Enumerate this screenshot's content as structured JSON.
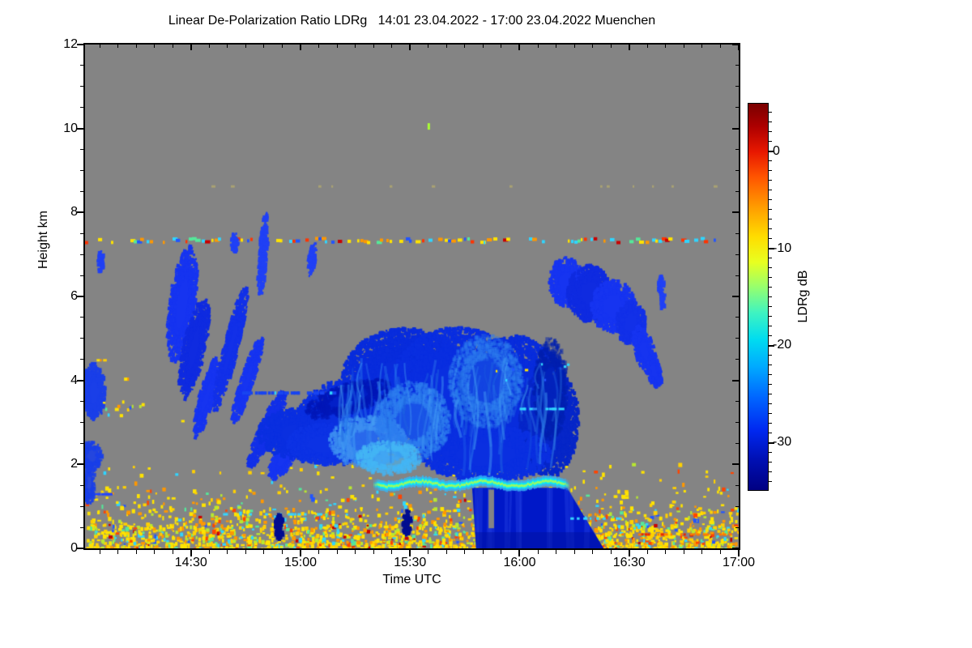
{
  "title": "Linear De-Polarization Ratio LDRg   14:01 23.04.2022 - 17:00 23.04.2022 Muenchen",
  "chart_data": {
    "type": "heatmap",
    "title": "Linear De-Polarization Ratio LDRg   14:01 23.04.2022 - 17:00 23.04.2022 Muenchen",
    "station": "Muenchen",
    "date": "23.04.2022",
    "time_span_utc": [
      "14:01",
      "17:00"
    ],
    "xlabel": "Time UTC",
    "ylabel": "Height km",
    "ylim_km": [
      0,
      12
    ],
    "x_total_minutes": 179,
    "x_ticks": [
      {
        "t": 29,
        "label": "14:30"
      },
      {
        "t": 59,
        "label": "15:00"
      },
      {
        "t": 89,
        "label": "15:30"
      },
      {
        "t": 119,
        "label": "16:00"
      },
      {
        "t": 149,
        "label": "16:30"
      },
      {
        "t": 179,
        "label": "17:00"
      }
    ],
    "x_minor_step_min": 5,
    "y_ticks": [
      {
        "km": 0,
        "label": "0"
      },
      {
        "km": 2,
        "label": "2"
      },
      {
        "km": 4,
        "label": "4"
      },
      {
        "km": 6,
        "label": "6"
      },
      {
        "km": 8,
        "label": "8"
      },
      {
        "km": 10,
        "label": "10"
      },
      {
        "km": 12,
        "label": "12"
      }
    ],
    "y_minor_step_km": 0.5,
    "colorbar": {
      "label": "LDRg dB",
      "max_db": 5,
      "min_db": -35,
      "ticks": [
        {
          "db": 0,
          "label": "0"
        },
        {
          "db": -10,
          "label": "-10"
        },
        {
          "db": -20,
          "label": "-20"
        },
        {
          "db": -30,
          "label": "-30"
        }
      ],
      "minor_step_db": 1,
      "colormap": "jet",
      "stops": [
        [
          0.0,
          "#7A0000"
        ],
        [
          0.06,
          "#AE0000"
        ],
        [
          0.125,
          "#E81800"
        ],
        [
          0.19,
          "#FF5500"
        ],
        [
          0.27,
          "#FF9E00"
        ],
        [
          0.345,
          "#FFDD00"
        ],
        [
          0.41,
          "#E8FF20"
        ],
        [
          0.475,
          "#96FF6E"
        ],
        [
          0.54,
          "#40F4C0"
        ],
        [
          0.61,
          "#00DCF0"
        ],
        [
          0.68,
          "#00AAFF"
        ],
        [
          0.76,
          "#0066FF"
        ],
        [
          0.845,
          "#0028F0"
        ],
        [
          0.92,
          "#0010B4"
        ],
        [
          1.0,
          "#000082"
        ]
      ]
    },
    "no_data_color": "#848484",
    "palettes": {
      "warm": [
        [
          "#FFE300",
          40
        ],
        [
          "#FFD000",
          18
        ],
        [
          "#FF9800",
          14
        ],
        [
          "#B8E830",
          8
        ],
        [
          "#55E89A",
          5
        ],
        [
          "#30D5FF",
          6
        ],
        [
          "#FF4400",
          5
        ],
        [
          "#C80000",
          2
        ],
        [
          "#2255FF",
          2
        ]
      ],
      "line73": [
        [
          "#FFE300",
          25
        ],
        [
          "#FF9800",
          18
        ],
        [
          "#FF3300",
          12
        ],
        [
          "#30D5FF",
          18
        ],
        [
          "#55E89A",
          10
        ],
        [
          "#2255FF",
          12
        ],
        [
          "#C80000",
          5
        ]
      ]
    },
    "features": {
      "ground_speckle_bands": [
        {
          "km0": 0.0,
          "km1": 0.18,
          "density": 0.85,
          "palette": "warm"
        },
        {
          "km0": 0.18,
          "km1": 0.6,
          "density": 0.5,
          "palette": "warm"
        },
        {
          "km0": 0.6,
          "km1": 0.95,
          "density": 0.22,
          "palette": "warm"
        },
        {
          "km0": 0.95,
          "km1": 1.5,
          "density": 0.08,
          "palette": "warm"
        },
        {
          "km0": 1.5,
          "km1": 2.05,
          "density": 0.02,
          "palette": "warm"
        }
      ],
      "speckle_rows_under": [
        {
          "name": "artifact-line-7.3km",
          "t0": 0,
          "t1": 179,
          "km": 7.33,
          "cov": 0.5,
          "palette": "line73",
          "h": 4,
          "wmax": 7,
          "spread": 0.1
        },
        {
          "name": "faint-line-8.6km",
          "t0": 0,
          "t1": 179,
          "km": 8.62,
          "cov": 0.07,
          "colors": [
            [
              "#D8C860",
              1
            ]
          ],
          "alpha": 0.45,
          "h": 3,
          "wmax": 5
        },
        {
          "name": "row-4.5km-left",
          "t0": 0.5,
          "t1": 12.5,
          "km": 4.48,
          "cov": 0.15,
          "palette": "warm",
          "h": 3,
          "wmax": 5
        },
        {
          "name": "row-4.0km-left",
          "t0": 1.8,
          "t1": 13.5,
          "km": 4.03,
          "cov": 0.3,
          "colors": [
            [
              "#30D5FF",
              40
            ],
            [
              "#FF9800",
              25
            ],
            [
              "#FFE300",
              35
            ]
          ],
          "h": 4,
          "wmax": 6
        },
        {
          "name": "cluster-3.3km-left",
          "t0": 1.5,
          "t1": 16,
          "km": 3.32,
          "cov": 0.55,
          "palette": "warm",
          "h": 4,
          "spread": 0.35,
          "step": 3,
          "wmax": 5
        },
        {
          "name": "row-3.0km",
          "t0": 21,
          "t1": 44,
          "km": 3.03,
          "cov": 0.15,
          "colors": [
            [
              "#FFE300",
              70
            ],
            [
              "#55E89A",
              30
            ]
          ],
          "h": 3,
          "wmax": 5
        },
        {
          "name": "cyan-1km-left",
          "t0": 36,
          "t1": 66,
          "km": 0.81,
          "cov": 0.35,
          "colors": [
            [
              "#35D5FF",
              85
            ],
            [
              "#2255FF",
              15
            ]
          ],
          "h": 3,
          "wmax": 7
        },
        {
          "name": "blue-dashes-1.3km-left",
          "t0": 1.8,
          "t1": 6.4,
          "km": 1.29,
          "cov": 0.8,
          "colors": [
            [
              "#2244FF",
              1
            ]
          ],
          "h": 3,
          "wmax": 8
        },
        {
          "name": "green-dash-10km",
          "t0": 93.8,
          "t1": 94.6,
          "km": 10.05,
          "cov": 1,
          "colors": [
            [
              "#AAFF33",
              1
            ]
          ],
          "h": 8,
          "wmax": 3
        }
      ],
      "blobs": [
        {
          "name": "fallstreak-a1",
          "t": 26.6,
          "km": 5.83,
          "rt": 3.1,
          "rkm": 1.2,
          "rot": 8,
          "color": "#1634F0"
        },
        {
          "name": "fallstreak-a2",
          "t": 29.9,
          "km": 4.77,
          "rt": 2.7,
          "rkm": 1.06,
          "rot": 12,
          "color": "#0F2BE0"
        },
        {
          "name": "fallstreak-a3",
          "t": 33.3,
          "km": 3.61,
          "rt": 1.8,
          "rkm": 0.87,
          "rot": 15,
          "color": "#1634F0"
        },
        {
          "name": "fallstreak-b",
          "t": 39.9,
          "km": 4.77,
          "rt": 1.8,
          "rkm": 1.35,
          "rot": 14,
          "color": "#1230E8"
        },
        {
          "name": "fallstreak-c1",
          "t": 44.4,
          "km": 3.99,
          "rt": 1.55,
          "rkm": 0.96,
          "rot": 18,
          "color": "#1634F0"
        },
        {
          "name": "fallstreak-c2",
          "t": 49.9,
          "km": 2.84,
          "rt": 2.0,
          "rkm": 0.87,
          "rot": 25,
          "color": "#1230E8"
        },
        {
          "name": "fallstreak-c3",
          "t": 54.8,
          "km": 2.22,
          "rt": 2.4,
          "rkm": 0.58,
          "rot": 30,
          "color": "#1634F0"
        },
        {
          "name": "streak-tall-1449",
          "t": 48.8,
          "km": 7.0,
          "rt": 1.0,
          "rkm": 0.89,
          "rot": 4,
          "color": "#2040F5"
        },
        {
          "name": "streak-bit",
          "t": 41.0,
          "km": 7.27,
          "rt": 0.9,
          "rkm": 0.23,
          "rot": 0,
          "color": "#2040F5"
        },
        {
          "name": "streak-1505",
          "t": 62.1,
          "km": 6.89,
          "rt": 0.9,
          "rkm": 0.35,
          "rot": 8,
          "color": "#2040F5"
        },
        {
          "name": "left-edge-patch",
          "t": 2.4,
          "km": 3.74,
          "rt": 2.9,
          "rkm": 0.58,
          "rot": 0,
          "color": "#1A3FE8"
        },
        {
          "name": "left-edge-dash-6.8km",
          "t": 4.4,
          "km": 6.83,
          "rt": 0.7,
          "rkm": 0.23,
          "rot": 0,
          "color": "#2040F5"
        },
        {
          "name": "left-edge-low1",
          "t": 1.7,
          "km": 2.2,
          "rt": 2.6,
          "rkm": 0.3,
          "rot": 0,
          "color": "#1A3FE8",
          "alpha": 0.9
        },
        {
          "name": "left-edge-low2",
          "t": 1.1,
          "km": 1.55,
          "rt": 1.4,
          "rkm": 0.45,
          "rot": 0,
          "color": "#1A3FE8",
          "alpha": 0.85
        },
        {
          "name": "main-cloud-1",
          "t": 58.8,
          "km": 2.74,
          "rt": 10.0,
          "rkm": 0.52,
          "rot": 0,
          "color": "#0A2FE0"
        },
        {
          "name": "main-cloud-2",
          "t": 72.1,
          "km": 3.03,
          "rt": 12.2,
          "rkm": 0.87,
          "rot": 0,
          "color": "#0A2FE0"
        },
        {
          "name": "main-cloud-3",
          "t": 87.6,
          "km": 3.96,
          "rt": 15.1,
          "rkm": 1.12,
          "rot": 0,
          "color": "#082CDC"
        },
        {
          "name": "main-cloud-4",
          "t": 102.0,
          "km": 3.67,
          "rt": 16.6,
          "rkm": 1.39,
          "rot": 0,
          "color": "#092EE0"
        },
        {
          "name": "main-cloud-5",
          "t": 117.6,
          "km": 3.51,
          "rt": 12.9,
          "rkm": 1.35,
          "rot": 0,
          "color": "#082CDC"
        },
        {
          "name": "main-cloud-6",
          "t": 127.1,
          "km": 3.03,
          "rt": 7.1,
          "rkm": 1.12,
          "rot": 0,
          "color": "#0626C8"
        },
        {
          "name": "main-cloud-7",
          "t": 109.8,
          "km": 2.26,
          "rt": 15.5,
          "rkm": 0.58,
          "rot": 0,
          "color": "#0A2FE0"
        },
        {
          "name": "main-cloud-8",
          "t": 65.4,
          "km": 2.49,
          "rt": 8.9,
          "rkm": 0.42,
          "rot": 0,
          "color": "#0C32E4"
        },
        {
          "name": "main-cloud-dark-top",
          "t": 72.1,
          "km": 3.57,
          "rt": 10.6,
          "rkm": 0.31,
          "rot": -18,
          "color": "#0018B8",
          "alpha": 0.6
        },
        {
          "name": "main-cloud-dark-right",
          "t": 127.5,
          "km": 3.8,
          "rt": 4.0,
          "rkm": 1.06,
          "rot": 0,
          "color": "#001FB0",
          "alpha": 0.5
        },
        {
          "name": "main-cloud-light-1",
          "t": 77.6,
          "km": 2.55,
          "rt": 9.3,
          "rkm": 0.54,
          "rot": 0,
          "color": "#3E8FF2",
          "alpha": 0.6
        },
        {
          "name": "main-cloud-light-2",
          "t": 89.8,
          "km": 3.03,
          "rt": 8.9,
          "rkm": 0.81,
          "rot": 0,
          "color": "#2E7FF0",
          "alpha": 0.45
        },
        {
          "name": "main-cloud-light-3",
          "t": 109.8,
          "km": 3.99,
          "rt": 8.9,
          "rkm": 0.96,
          "rot": 0,
          "color": "#2E7FF0",
          "alpha": 0.3
        },
        {
          "name": "main-cloud-bright-low",
          "t": 83.2,
          "km": 2.16,
          "rt": 7.8,
          "rkm": 0.35,
          "rot": 0,
          "color": "#45B5F5",
          "alpha": 0.6
        },
        {
          "name": "right-cloud-1",
          "t": 132.0,
          "km": 6.35,
          "rt": 4.4,
          "rkm": 0.5,
          "rot": 0,
          "color": "#1634F0"
        },
        {
          "name": "right-cloud-2",
          "t": 138.2,
          "km": 6.08,
          "rt": 5.3,
          "rkm": 0.58,
          "rot": 0,
          "color": "#0F2BE0"
        },
        {
          "name": "right-cloud-3",
          "t": 144.6,
          "km": 5.77,
          "rt": 5.3,
          "rkm": 0.54,
          "rot": 0,
          "color": "#1634F0"
        },
        {
          "name": "right-cloud-4",
          "t": 149.5,
          "km": 5.38,
          "rt": 3.5,
          "rkm": 0.46,
          "rot": 0,
          "color": "#1230E8"
        },
        {
          "name": "right-cloud-tail-1",
          "t": 153.1,
          "km": 4.73,
          "rt": 2.4,
          "rkm": 0.52,
          "rot": -15,
          "color": "#1634F0"
        },
        {
          "name": "right-cloud-tail-2",
          "t": 155.9,
          "km": 4.23,
          "rt": 1.6,
          "rkm": 0.35,
          "rot": -10,
          "color": "#1634F0"
        },
        {
          "name": "right-cloud-dash-1",
          "t": 157.7,
          "km": 6.31,
          "rt": 0.7,
          "rkm": 0.23,
          "rot": 0,
          "color": "#2040F5"
        },
        {
          "name": "right-cloud-dash-2",
          "t": 158.2,
          "km": 5.92,
          "rt": 0.7,
          "rkm": 0.17,
          "rot": 0,
          "color": "#2040F5"
        },
        {
          "name": "right-cloud-bit",
          "t": 129.8,
          "km": 6.69,
          "rt": 1.3,
          "rkm": 0.15,
          "rot": 0,
          "color": "#1634F0"
        },
        {
          "name": "navy-column-1",
          "t": 53.2,
          "km": 0.52,
          "rt": 1.1,
          "rkm": 0.27,
          "rot": 0,
          "color": "#000D90"
        },
        {
          "name": "navy-column-2",
          "t": 88.1,
          "km": 0.6,
          "rt": 1.1,
          "rkm": 0.27,
          "rot": 0,
          "color": "#000D90"
        }
      ],
      "wisps": {
        "count": 90,
        "t0": 69,
        "t1": 130,
        "km_top": 4.6,
        "km_bot": 1.8,
        "colors": [
          "#2E86F0",
          "#49A5F5",
          "#1E66E0"
        ]
      },
      "melting_band": {
        "t0": 78.5,
        "t1": 132.6,
        "km": 1.55,
        "amp_km": 0.06,
        "color_outer": "#35B8F8",
        "color_mid": "#00F0FF",
        "color_core": "#A6FF55"
      },
      "rain_shaft": {
        "poly": [
          [
            106.0,
            1.44
          ],
          [
            132.0,
            1.44
          ],
          [
            142.0,
            0.0
          ],
          [
            107.1,
            0.0
          ]
        ],
        "color": "#0018C8",
        "streak_color": "#2A4AE8",
        "base_color": "#000FA0",
        "notch": {
          "t0": 110.5,
          "t1": 112.0,
          "km0": 0.48,
          "km1": 1.4
        }
      },
      "speckle_rows_over": [
        {
          "name": "blue-dash-row-3.7km",
          "t0": 43,
          "t1": 70,
          "km": 3.7,
          "cov": 0.5,
          "colors": [
            [
              "#1844F0",
              80
            ],
            [
              "#30D5FF",
              20
            ]
          ],
          "h": 4,
          "wmax": 8
        },
        {
          "name": "speckles-cloud-top",
          "t0": 108,
          "t1": 132,
          "km": 4.25,
          "cov": 0.2,
          "colors": [
            [
              "#30D5FF",
              40
            ],
            [
              "#FFE300",
              35
            ],
            [
              "#2255FF",
              25
            ]
          ],
          "h": 3,
          "spread": 0.5,
          "wmax": 5
        },
        {
          "name": "cyan-row-3.3km",
          "t0": 119,
          "t1": 131,
          "km": 3.32,
          "cov": 0.35,
          "colors": [
            [
              "#30D5FF",
              70
            ],
            [
              "#2E86F0",
              30
            ]
          ],
          "h": 3,
          "wmax": 8
        },
        {
          "name": "cyan-1km-right",
          "t0": 132,
          "t1": 147.5,
          "km": 0.71,
          "cov": 0.35,
          "colors": [
            [
              "#35D5FF",
              1
            ]
          ],
          "h": 3,
          "wmax": 6
        },
        {
          "name": "orange-dotted-line-right",
          "t0": 147,
          "t1": 179,
          "km": 0.33,
          "cov": 0.5,
          "colors": [
            [
              "#FF7A00",
              55
            ],
            [
              "#E82800",
              45
            ]
          ],
          "h": 3,
          "wmax": 5
        }
      ]
    }
  }
}
